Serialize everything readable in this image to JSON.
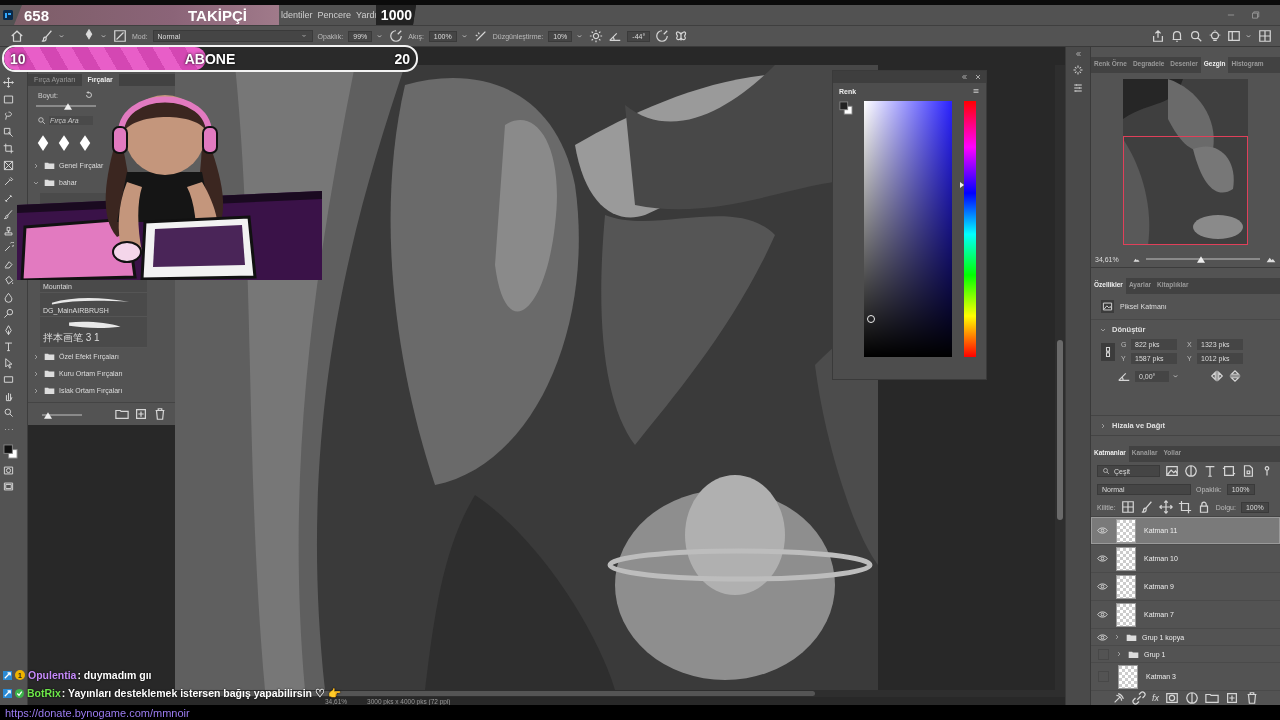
{
  "menu": {
    "items": [
      "ldentiler",
      "Pencere",
      "Yardı"
    ]
  },
  "followers": {
    "count": "658",
    "label": "TAKİPÇİ",
    "goal": "1000",
    "level": 0.66
  },
  "subscribers": {
    "count": "10",
    "label": "ABONE",
    "goal": "20",
    "level": 0.49
  },
  "options_bar": {
    "mode_label": "Mod:",
    "mode": "Normal",
    "opacity_label": "Opaklık:",
    "opacity": "99%",
    "flow_label": "Akış:",
    "flow": "100%",
    "smoothing_label": "Düzgünleştirme:",
    "smoothing": "10%",
    "angle": "-44°"
  },
  "brush_panel": {
    "tabs": [
      {
        "label": "Fırça Ayarları",
        "selected": false
      },
      {
        "label": "Fırçalar",
        "selected": true
      }
    ],
    "size_label": "Boyut:",
    "size_slider": {
      "level": 0.53
    },
    "search": {
      "placeholder": "Fırça Ara"
    },
    "folders_top": [
      {
        "name": "Genel Fırçalar",
        "expanded": false
      },
      {
        "name": "bahar",
        "expanded": true
      }
    ],
    "presets": [
      {
        "name": "Mountain"
      },
      {
        "name": "DG_MainAIRBRUSH"
      },
      {
        "name": "拌本画笔 3 1"
      }
    ],
    "folders_bottom": [
      {
        "name": "Özel Efekt Fırçaları",
        "expanded": false
      },
      {
        "name": "Kuru Ortam Fırçaları",
        "expanded": false
      },
      {
        "name": "Islak Ortam Fırçaları",
        "expanded": false
      }
    ],
    "preview_slider": {
      "level": 0.15
    }
  },
  "color_panel": {
    "title": "Renk",
    "hue_slider": {
      "level": 0.67
    }
  },
  "status_bar": {
    "zoom": "34,61%",
    "size": "3000 pks x 4000 pks (72 ppi)"
  },
  "navigator_panel": {
    "tabs": [
      {
        "label": "Renk Örne",
        "selected": false
      },
      {
        "label": "Degradele",
        "selected": false
      },
      {
        "label": "Desenler",
        "selected": false
      },
      {
        "label": "Gezgin",
        "selected": true
      },
      {
        "label": "Histogram",
        "selected": false
      }
    ],
    "zoom": "34,61%",
    "zoom_slider": {
      "level": 0.48
    }
  },
  "properties_panel": {
    "tabs": [
      {
        "label": "Özellikler",
        "selected": true
      },
      {
        "label": "Ayarlar",
        "selected": false
      },
      {
        "label": "Kitaplıklar",
        "selected": false
      }
    ],
    "layer_type": "Piksel Katmanı",
    "transform": {
      "title": "Dönüştür",
      "expanded": true,
      "fields": [
        {
          "label": "G",
          "value": "822 pks"
        },
        {
          "label": "X",
          "value": "1323 pks"
        },
        {
          "label": "Y",
          "value": "1587 pks"
        },
        {
          "label": "Y",
          "value": "1012 pks"
        }
      ],
      "angle": "0,00°"
    },
    "align": {
      "title": "Hizala ve Dağıt",
      "expanded": false
    }
  },
  "layers_panel": {
    "tabs": [
      {
        "label": "Katmanlar",
        "selected": true
      },
      {
        "label": "Kanallar",
        "selected": false
      },
      {
        "label": "Yollar",
        "selected": false
      }
    ],
    "filter": "Çeşit",
    "blend_mode": "Normal",
    "opacity_label": "Opaklık:",
    "opacity": "100%",
    "lock_label": "Kilitle:",
    "fill_label": "Dolgu:",
    "fill": "100%",
    "layers": [
      {
        "kind": "layer",
        "name": "Katman 11",
        "visible": true,
        "selected": true
      },
      {
        "kind": "layer",
        "name": "Katman 10",
        "visible": true,
        "selected": false
      },
      {
        "kind": "layer",
        "name": "Katman 9",
        "visible": true,
        "selected": false
      },
      {
        "kind": "layer",
        "name": "Katman 7",
        "visible": true,
        "selected": false
      },
      {
        "kind": "group",
        "name": "Grup 1 kopya",
        "visible": true,
        "selected": false
      },
      {
        "kind": "group",
        "name": "Grup 1",
        "visible": false,
        "selected": false
      },
      {
        "kind": "layer",
        "name": "Katman 3",
        "visible": false,
        "selected": false
      }
    ],
    "fx_label": "fx"
  },
  "chat": {
    "messages": [
      {
        "user": "Opulentia",
        "color": "#c58af9",
        "text": ": duymadım gıı",
        "kind": "count",
        "badge_text": "1"
      },
      {
        "user": "BotRix",
        "color": "#6ee84a",
        "text": ": Yayınları desteklemek istersen bağış yapabilirsin ♡ 👉",
        "kind": "verified"
      }
    ],
    "link": "https://donate.bynogame.com/mmnoir"
  }
}
